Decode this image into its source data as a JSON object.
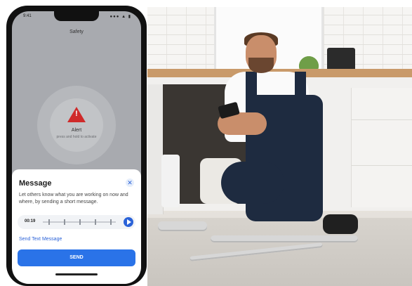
{
  "phone": {
    "status": {
      "time": "9:41",
      "icons": "●●● ▲ ▮"
    },
    "screen_title": "Safety",
    "alert": {
      "label": "Alert",
      "sublabel": "press and hold to activate",
      "icon": "warning-triangle-icon",
      "color": "#cf2a2a"
    },
    "message_sheet": {
      "title": "Message",
      "close_icon": "close-icon",
      "description": "Let others know what you are working on now and where, by sending a short message.",
      "recording_time": "00:19",
      "send_text_link": "Send Text Message",
      "send_button": "SEND",
      "accent_color": "#2a73e8"
    }
  }
}
